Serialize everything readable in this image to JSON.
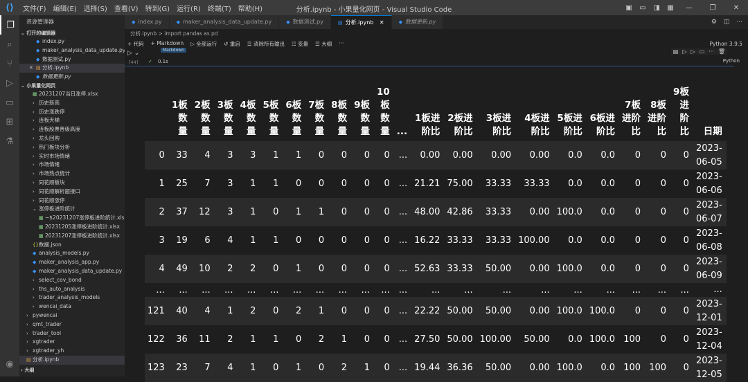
{
  "titlebar": {
    "menu": [
      "文件(F)",
      "编辑(E)",
      "选择(S)",
      "查看(V)",
      "转到(G)",
      "运行(R)",
      "终端(T)",
      "帮助(H)"
    ],
    "title": "分析.ipynb - 小果量化网页 - Visual Studio Code"
  },
  "sidebar": {
    "header": "资源管理器",
    "open_editors_title": "打开的编辑器",
    "open_editors": [
      {
        "name": "index.py",
        "type": "py"
      },
      {
        "name": "maker_analysis_data_update.py...",
        "type": "py"
      },
      {
        "name": "数据测试.py",
        "type": "py"
      },
      {
        "name": "分析.ipynb",
        "type": "nb",
        "close": "✕"
      },
      {
        "name": "数据更新.py",
        "type": "py",
        "italic": true
      }
    ],
    "workspace_title": "小果量化网页",
    "tree": [
      {
        "name": "20231207当日涨停.xlsx",
        "type": "xl",
        "indent": 1
      },
      {
        "name": "历史新高",
        "type": "folder",
        "indent": 1
      },
      {
        "name": "历史涨跌停",
        "type": "folder",
        "indent": 1
      },
      {
        "name": "连板天梯",
        "type": "folder",
        "indent": 1
      },
      {
        "name": "连板股票晋级高度",
        "type": "folder",
        "indent": 1
      },
      {
        "name": "龙头回购",
        "type": "folder",
        "indent": 1
      },
      {
        "name": "热门板块分析",
        "type": "folder",
        "indent": 1
      },
      {
        "name": "实时市场情绪",
        "type": "folder",
        "indent": 1
      },
      {
        "name": "市场情绪",
        "type": "folder",
        "indent": 1
      },
      {
        "name": "市场热点统计",
        "type": "folder",
        "indent": 1
      },
      {
        "name": "同花顺板块",
        "type": "folder",
        "indent": 1
      },
      {
        "name": "同花顺解析题接口",
        "type": "folder",
        "indent": 1
      },
      {
        "name": "同花顺涨停",
        "type": "folder",
        "indent": 1
      },
      {
        "name": "涨停板进阶统计",
        "type": "open-folder",
        "indent": 1
      },
      {
        "name": "~$20231207涨停板进阶统计.xlsx",
        "type": "xl",
        "indent": 2
      },
      {
        "name": "20231205涨停板进阶统计.xlsx",
        "type": "xl",
        "indent": 2
      },
      {
        "name": "20231207涨停板进阶统计.xlsx",
        "type": "xl",
        "indent": 2
      },
      {
        "name": "数据.json",
        "type": "js",
        "indent": 1
      },
      {
        "name": "analysis_models.py",
        "type": "py",
        "indent": 1
      },
      {
        "name": "maker_analysis_app.py",
        "type": "py",
        "indent": 1
      },
      {
        "name": "maker_analysis_data_update.py",
        "type": "py",
        "indent": 1
      },
      {
        "name": "select_cov_bond",
        "type": "folder",
        "indent": 1
      },
      {
        "name": "ths_auto_analysis",
        "type": "folder",
        "indent": 1
      },
      {
        "name": "trader_analysis_models",
        "type": "folder",
        "indent": 1
      },
      {
        "name": "wencai_data",
        "type": "folder",
        "indent": 1
      },
      {
        "name": "pywencai",
        "type": "folder",
        "indent": 0
      },
      {
        "name": "qmt_trader",
        "type": "folder",
        "indent": 0
      },
      {
        "name": "trader_tool",
        "type": "folder",
        "indent": 0
      },
      {
        "name": "xgtrader",
        "type": "folder",
        "indent": 0
      },
      {
        "name": "xgtrader_yh",
        "type": "folder",
        "indent": 0
      },
      {
        "name": "分析.ipynb",
        "type": "nb",
        "indent": 0,
        "selected": true
      }
    ],
    "outline_title": "大纲"
  },
  "tabs": [
    {
      "label": "index.py",
      "active": false
    },
    {
      "label": "maker_analysis_data_update.py",
      "active": false
    },
    {
      "label": "数据测试.py",
      "active": false
    },
    {
      "label": "分析.ipynb",
      "active": true,
      "close": "✕"
    },
    {
      "label": "数据更新.py",
      "active": false
    }
  ],
  "breadcrumb": "分析.ipynb > import pandas as pd",
  "toolbar": {
    "items": [
      "+ 代码",
      "+ Markdown",
      "▷ 全部运行",
      "↺ 重启",
      "☰ 清除所有输出",
      "☷ 变量",
      "☰ 大纲",
      "···"
    ],
    "kernel": "Python 3.9.5"
  },
  "cell": {
    "exec_count": "[44]",
    "time": "0.1s",
    "lang": "Python",
    "md_tag": "Markdown"
  },
  "table": {
    "headers": [
      "",
      "1板\n数\n量",
      "2板\n数\n量",
      "3板\n数\n量",
      "4板\n数\n量",
      "5板\n数\n量",
      "6板\n数\n量",
      "7板\n数\n量",
      "8板\n数\n量",
      "9板\n数\n量",
      "10\n板\n数\n量",
      "...",
      "1板进\n阶比",
      "2板进\n阶比",
      "3板进\n阶比",
      "4板进\n阶比",
      "5板进\n阶比",
      "6板进\n阶比",
      "7板\n进阶\n比",
      "8板\n进阶\n比",
      "9板\n进\n阶\n比",
      "日期"
    ],
    "rows": [
      [
        "0",
        "33",
        "4",
        "3",
        "3",
        "1",
        "1",
        "0",
        "0",
        "0",
        "0",
        "...",
        "0.00",
        "0.00",
        "0.00",
        "0.00",
        "0.0",
        "0.0",
        "0",
        "0",
        "0",
        "2023-\n06-05"
      ],
      [
        "1",
        "25",
        "7",
        "3",
        "1",
        "1",
        "0",
        "0",
        "0",
        "0",
        "0",
        "...",
        "21.21",
        "75.00",
        "33.33",
        "33.33",
        "0.0",
        "0.0",
        "0",
        "0",
        "0",
        "2023-\n06-06"
      ],
      [
        "2",
        "37",
        "12",
        "3",
        "1",
        "0",
        "1",
        "1",
        "0",
        "0",
        "0",
        "...",
        "48.00",
        "42.86",
        "33.33",
        "0.00",
        "100.0",
        "0.0",
        "0",
        "0",
        "0",
        "2023-\n06-07"
      ],
      [
        "3",
        "19",
        "6",
        "4",
        "1",
        "1",
        "0",
        "0",
        "0",
        "0",
        "0",
        "...",
        "16.22",
        "33.33",
        "33.33",
        "100.00",
        "0.0",
        "0.0",
        "0",
        "0",
        "0",
        "2023-\n06-08"
      ],
      [
        "4",
        "49",
        "10",
        "2",
        "2",
        "0",
        "1",
        "0",
        "0",
        "0",
        "0",
        "...",
        "52.63",
        "33.33",
        "50.00",
        "0.00",
        "100.0",
        "0.0",
        "0",
        "0",
        "0",
        "2023-\n06-09"
      ],
      [
        "...",
        "...",
        "...",
        "...",
        "...",
        "...",
        "...",
        "...",
        "...",
        "...",
        "...",
        "...",
        "...",
        "...",
        "...",
        "...",
        "...",
        "...",
        "...",
        "...",
        "...",
        "..."
      ],
      [
        "121",
        "40",
        "4",
        "1",
        "2",
        "0",
        "2",
        "1",
        "0",
        "0",
        "0",
        "...",
        "22.22",
        "50.00",
        "50.00",
        "0.00",
        "100.0",
        "100.0",
        "0",
        "0",
        "0",
        "2023-\n12-01"
      ],
      [
        "122",
        "36",
        "11",
        "2",
        "1",
        "1",
        "0",
        "2",
        "1",
        "0",
        "0",
        "...",
        "27.50",
        "50.00",
        "100.00",
        "50.00",
        "0.0",
        "100.0",
        "100",
        "0",
        "0",
        "2023-\n12-04"
      ],
      [
        "123",
        "23",
        "7",
        "4",
        "1",
        "0",
        "1",
        "0",
        "2",
        "1",
        "0",
        "...",
        "19.44",
        "36.36",
        "50.00",
        "0.00",
        "100.0",
        "0.0",
        "100",
        "100",
        "0",
        "2023-\n12-05"
      ]
    ]
  }
}
